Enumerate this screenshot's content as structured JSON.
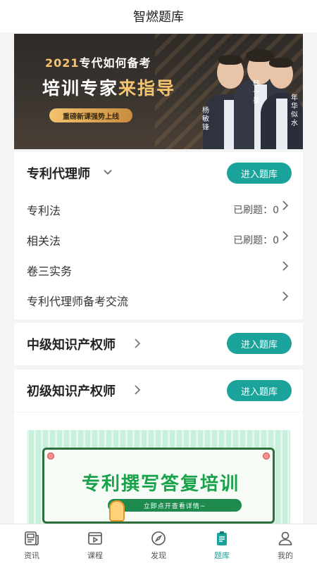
{
  "header": {
    "title": "智燃题库"
  },
  "banner": {
    "year": "2021",
    "line1_rest": "专代如何备考",
    "line2_main": "培训专家",
    "line2_highlight": "来指导",
    "pill": "重磅新课强势上线",
    "teachers": [
      "杨敏锋",
      "韩一星",
      "年华似水"
    ]
  },
  "sections": [
    {
      "title": "专利代理师",
      "button": "进入题库",
      "rows": [
        {
          "label": "专利法",
          "count": "已刷题：0"
        },
        {
          "label": "相关法",
          "count": "已刷题：0"
        },
        {
          "label": "卷三实务",
          "count": ""
        },
        {
          "label": "专利代理师备考交流",
          "count": ""
        }
      ]
    },
    {
      "title": "中级知识产权师",
      "button": "进入题库"
    },
    {
      "title": "初级知识产权师",
      "button": "进入题库"
    }
  ],
  "promo": {
    "title": "专利撰写答复培训",
    "pill": "立即点开查看详情~"
  },
  "tabbar": {
    "items": [
      {
        "label": "资讯",
        "icon": "news-icon"
      },
      {
        "label": "课程",
        "icon": "course-icon"
      },
      {
        "label": "发现",
        "icon": "compass-icon"
      },
      {
        "label": "题库",
        "icon": "question-bank-icon"
      },
      {
        "label": "我的",
        "icon": "user-icon"
      }
    ],
    "active": "题库"
  },
  "colors": {
    "accent": "#1aa39a",
    "banner_gold": "#f3c36e",
    "promo_green": "#18a24a"
  }
}
